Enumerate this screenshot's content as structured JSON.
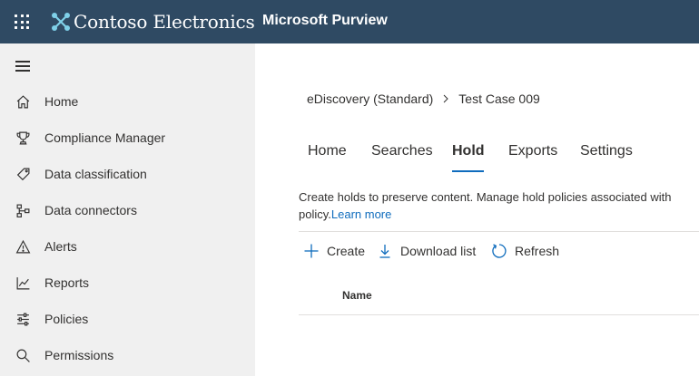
{
  "header": {
    "brand": "Contoso Electronics",
    "app": "Microsoft Purview",
    "bg_color": "#2f4a63"
  },
  "sidebar": {
    "items": [
      {
        "label": "Home",
        "icon": "home-icon"
      },
      {
        "label": "Compliance Manager",
        "icon": "trophy-icon"
      },
      {
        "label": "Data classification",
        "icon": "tag-icon"
      },
      {
        "label": "Data connectors",
        "icon": "connector-icon"
      },
      {
        "label": "Alerts",
        "icon": "warning-icon"
      },
      {
        "label": "Reports",
        "icon": "chart-line-icon"
      },
      {
        "label": "Policies",
        "icon": "sliders-icon"
      },
      {
        "label": "Permissions",
        "icon": "key-search-icon"
      }
    ]
  },
  "breadcrumb": {
    "parent": "eDiscovery (Standard)",
    "current": "Test Case 009"
  },
  "tabs": [
    {
      "label": "Home",
      "active": false
    },
    {
      "label": "Searches",
      "active": false
    },
    {
      "label": "Hold",
      "active": true
    },
    {
      "label": "Exports",
      "active": false
    },
    {
      "label": "Settings",
      "active": false
    }
  ],
  "description": {
    "text_line1": "Create holds to preserve content. Manage hold policies associated with",
    "text_line2": "policy.",
    "link": "Learn more"
  },
  "commands": {
    "create": "Create",
    "download": "Download list",
    "refresh": "Refresh"
  },
  "table": {
    "columns": [
      "Name"
    ]
  },
  "colors": {
    "accent": "#0f6cbd",
    "sidebar_bg": "#f0f0f0"
  }
}
